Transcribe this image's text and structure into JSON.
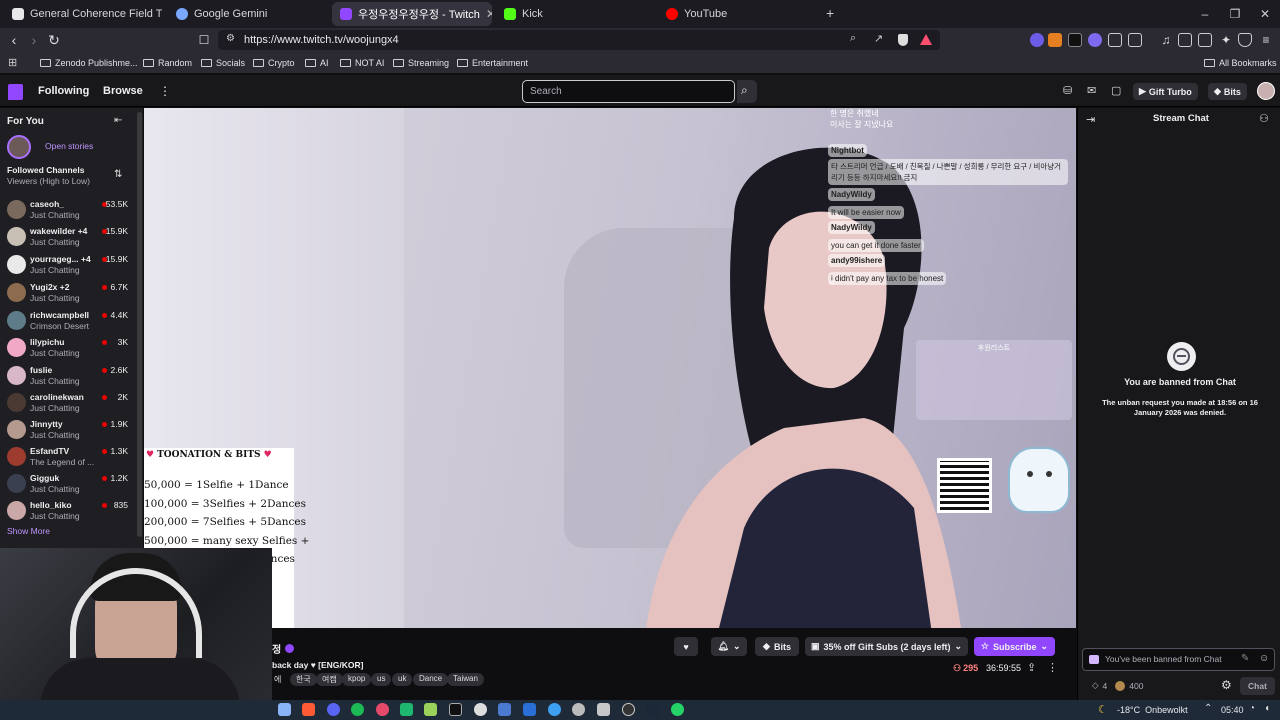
{
  "browser": {
    "tabs": [
      {
        "label": "General Coherence Field Theory (GC",
        "icon": "app-icon",
        "color": "#e8e8ea"
      },
      {
        "label": "Google Gemini",
        "icon": "gemini-icon",
        "color": "#7aa7ff"
      },
      {
        "label": "우정우정우정우정 - Twitch",
        "icon": "twitch-icon",
        "color": "#9147ff"
      },
      {
        "label": "Kick",
        "icon": "kick-icon",
        "color": "#53fc18"
      },
      {
        "label": "YouTube",
        "icon": "youtube-icon",
        "color": "#ff0000"
      }
    ],
    "new_tab": "+",
    "url": "https://www.twitch.tv/woojungx4",
    "bookmarks": [
      "Zenodo Publishme...",
      "Random",
      "Socials",
      "Crypto",
      "AI",
      "NOT AI",
      "Streaming",
      "Entertainment"
    ],
    "all_bookmarks": "All Bookmarks"
  },
  "twitch": {
    "nav": {
      "following": "Following",
      "browse": "Browse",
      "more": "⋮"
    },
    "search_placeholder": "Search",
    "gift_turbo": "Gift Turbo",
    "bits": "Bits",
    "accent": "#9147ff"
  },
  "sidebar": {
    "for_you": "For You",
    "open_stories": "Open stories",
    "followed_title": "Followed Channels",
    "followed_sort": "Viewers (High to Low)",
    "channels": [
      {
        "name": "caseoh_",
        "category": "Just Chatting",
        "viewers": "53.5K",
        "color": "#7a6a5e"
      },
      {
        "name": "wakewilder +4",
        "category": "Just Chatting",
        "viewers": "15.9K",
        "color": "#c9c0b5"
      },
      {
        "name": "yourrageg... +4",
        "category": "Just Chatting",
        "viewers": "15.9K",
        "color": "#e9e9e9"
      },
      {
        "name": "Yugi2x +2",
        "category": "Just Chatting",
        "viewers": "6.7K",
        "color": "#8d6b4f"
      },
      {
        "name": "richwcampbell",
        "category": "Crimson Desert",
        "viewers": "4.4K",
        "color": "#5e7b89"
      },
      {
        "name": "lilypichu",
        "category": "Just Chatting",
        "viewers": "3K",
        "color": "#f1a7c6"
      },
      {
        "name": "fuslie",
        "category": "Just Chatting",
        "viewers": "2.6K",
        "color": "#d8b8c7"
      },
      {
        "name": "carolinekwan",
        "category": "Just Chatting",
        "viewers": "2K",
        "color": "#4a3a33"
      },
      {
        "name": "Jinnytty",
        "category": "Just Chatting",
        "viewers": "1.9K",
        "color": "#b59a8f"
      },
      {
        "name": "EsfandTV",
        "category": "The Legend of ...",
        "viewers": "1.3K",
        "color": "#9c3b2e"
      },
      {
        "name": "Gigguk",
        "category": "Just Chatting",
        "viewers": "1.2K",
        "color": "#3b4050"
      },
      {
        "name": "hello_kiko",
        "category": "Just Chatting",
        "viewers": "835",
        "color": "#caa8a8"
      }
    ],
    "show_more": "Show More"
  },
  "video_overlay": {
    "chat_top_line1": "한 명은 취했네",
    "chat_top_line2": "이사는 잘 지냈나요",
    "messages": [
      {
        "user": "Nightbot",
        "text": "타 스트리머 언급 / 도배 / 친목질 / 나쁜말 / 성희롱 / 무리한 요구 / 비아냥거리기 등등 하지마세요!! 금지"
      },
      {
        "user": "NadyWildy",
        "text": "It will be easier now"
      },
      {
        "user": "NadyWildy",
        "text": "you can get it done faster"
      },
      {
        "user": "andy99ishere",
        "text": "i didn't pay any tax to be honest"
      }
    ],
    "counter": "0",
    "donation_list_title": "후원리스트",
    "toonation": {
      "title": "TOONATION & BITS",
      "rows": [
        "50,000 = 1Selfie + 1Dance",
        "100,000 = 3Selfies + 2Dances",
        "200,000 = 7Selfies + 5Dances",
        "500,000 = many sexy Selfies +",
        "Dances"
      ]
    }
  },
  "stream": {
    "title_prefix": "정",
    "subtitle": "back day ♥ [ENG/KOR]",
    "tags": [
      "에",
      "한국",
      "여캠",
      "kpop",
      "us",
      "uk",
      "Dance",
      "Taiwan"
    ],
    "actions": {
      "bits": "Bits",
      "gift_subs": "35% off Gift Subs (2 days left)",
      "subscribe": "Subscribe"
    },
    "viewers": "295",
    "uptime": "36:59:55"
  },
  "chat": {
    "title": "Stream Chat",
    "banned_title": "You are banned from Chat",
    "banned_detail": "The unban request you made at 18:56 on 16 January 2026 was denied.",
    "input_text": "You've been banned from Chat",
    "points_a": "4",
    "points_b": "400",
    "chat_button": "Chat"
  },
  "taskbar": {
    "weather": "-18°C  Onbewolkt",
    "time": "05:40"
  }
}
